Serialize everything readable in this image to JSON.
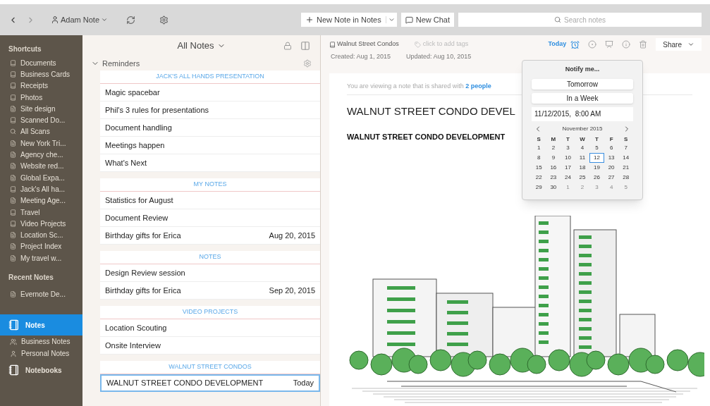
{
  "toolbar": {
    "account": "Adam Note",
    "new_note": "New Note in Notes",
    "new_chat": "New Chat",
    "search_placeholder": "Search notes"
  },
  "sidebar": {
    "shortcuts_title": "Shortcuts",
    "shortcuts": [
      {
        "label": "Documents",
        "kind": "notebook"
      },
      {
        "label": "Business Cards",
        "kind": "notebook"
      },
      {
        "label": "Receipts",
        "kind": "notebook"
      },
      {
        "label": "Photos",
        "kind": "notebook"
      },
      {
        "label": "Site design",
        "kind": "note"
      },
      {
        "label": "Scanned Do...",
        "kind": "notebook"
      },
      {
        "label": "All Scans",
        "kind": "search"
      },
      {
        "label": "New York Tri...",
        "kind": "note"
      },
      {
        "label": "Agency che...",
        "kind": "note"
      },
      {
        "label": "Website red...",
        "kind": "note"
      },
      {
        "label": "Global Expa...",
        "kind": "note"
      },
      {
        "label": "Jack's All ha...",
        "kind": "notebook"
      },
      {
        "label": "Meeting Age...",
        "kind": "note"
      },
      {
        "label": "Travel",
        "kind": "notebook"
      },
      {
        "label": "Video Projects",
        "kind": "notebook"
      },
      {
        "label": "Location Sc...",
        "kind": "note"
      },
      {
        "label": "Project Index",
        "kind": "note"
      },
      {
        "label": "My travel w...",
        "kind": "note"
      }
    ],
    "recent_title": "Recent Notes",
    "recent": [
      {
        "label": "Evernote De...",
        "kind": "note"
      }
    ],
    "nav": [
      {
        "label": "Notes",
        "kind": "main",
        "selected": true
      },
      {
        "label": "Business Notes",
        "kind": "sub",
        "selected": false
      },
      {
        "label": "Personal Notes",
        "kind": "person",
        "selected": false
      },
      {
        "label": "Notebooks",
        "kind": "main",
        "selected": false
      }
    ]
  },
  "notes_list": {
    "title": "All Notes",
    "reminders": {
      "label": "Reminders",
      "expanded": true
    },
    "groups": [
      {
        "title": "JACK'S ALL HANDS PRESENTATION",
        "items": [
          {
            "title": "Magic spacebar",
            "selected": false
          },
          {
            "title": "Phil's 3 rules for presentations",
            "selected": false
          },
          {
            "title": "Document handling",
            "selected": false
          },
          {
            "title": "Meetings happen",
            "selected": false
          },
          {
            "title": "What's Next",
            "selected": false
          }
        ]
      },
      {
        "title": "MY NOTES",
        "items": [
          {
            "title": "Statistics for August",
            "selected": false
          },
          {
            "title": "Document Review",
            "selected": false
          },
          {
            "title": "Birthday gifts for Erica",
            "date": "Aug 20, 2015",
            "selected": false
          }
        ]
      },
      {
        "title": "NOTES",
        "items": [
          {
            "title": "Design Review session",
            "selected": false
          },
          {
            "title": "Birthday gifts for Erica",
            "date": "Sep 20, 2015",
            "selected": false
          }
        ]
      },
      {
        "title": "VIDEO PROJECTS",
        "items": [
          {
            "title": "Location Scouting",
            "selected": false
          },
          {
            "title": "Onsite Interview",
            "selected": false
          }
        ]
      },
      {
        "title": "WALNUT STREET CONDOS",
        "items": [
          {
            "title": "WALNUT STREET CONDO DEVELOPMENT",
            "date": "Today",
            "selected": true
          }
        ]
      }
    ]
  },
  "editor": {
    "notebook": "Walnut Street Condos",
    "tags_placeholder": "click to add tags",
    "reminder": "Today",
    "share": "Share",
    "created": "Created: Aug 1, 2015",
    "updated": "Updated: Aug 10, 2015",
    "shared_text": "You are viewing a note that is shared with",
    "shared_link": "2 people",
    "title": "WALNUT STREET CONDO DEVEL",
    "heading": "WALNUT STREET CONDO DEVELOPMENT"
  },
  "reminder_popover": {
    "title": "Notify me...",
    "options": [
      "Tomorrow",
      "In a Week"
    ],
    "datetime": "11/12/2015,  8:00 AM",
    "month": "November 2015",
    "weekdays": [
      "S",
      "M",
      "T",
      "W",
      "T",
      "F",
      "S"
    ],
    "days": [
      {
        "label": "1",
        "kind": "current",
        "selected": false
      },
      {
        "label": "2",
        "kind": "current",
        "selected": false
      },
      {
        "label": "3",
        "kind": "current",
        "selected": false
      },
      {
        "label": "4",
        "kind": "current",
        "selected": false
      },
      {
        "label": "5",
        "kind": "current",
        "selected": false
      },
      {
        "label": "6",
        "kind": "current",
        "selected": false
      },
      {
        "label": "7",
        "kind": "current",
        "selected": false
      },
      {
        "label": "8",
        "kind": "current",
        "selected": false
      },
      {
        "label": "9",
        "kind": "current",
        "selected": false
      },
      {
        "label": "10",
        "kind": "current",
        "selected": false
      },
      {
        "label": "11",
        "kind": "current",
        "selected": false
      },
      {
        "label": "12",
        "kind": "current",
        "selected": true
      },
      {
        "label": "13",
        "kind": "current",
        "selected": false
      },
      {
        "label": "14",
        "kind": "current",
        "selected": false
      },
      {
        "label": "15",
        "kind": "current",
        "selected": false
      },
      {
        "label": "16",
        "kind": "current",
        "selected": false
      },
      {
        "label": "17",
        "kind": "current",
        "selected": false
      },
      {
        "label": "18",
        "kind": "current",
        "selected": false
      },
      {
        "label": "19",
        "kind": "current",
        "selected": false
      },
      {
        "label": "20",
        "kind": "current",
        "selected": false
      },
      {
        "label": "21",
        "kind": "current",
        "selected": false
      },
      {
        "label": "22",
        "kind": "current",
        "selected": false
      },
      {
        "label": "23",
        "kind": "current",
        "selected": false
      },
      {
        "label": "24",
        "kind": "current",
        "selected": false
      },
      {
        "label": "25",
        "kind": "current",
        "selected": false
      },
      {
        "label": "26",
        "kind": "current",
        "selected": false
      },
      {
        "label": "27",
        "kind": "current",
        "selected": false
      },
      {
        "label": "28",
        "kind": "current",
        "selected": false
      },
      {
        "label": "29",
        "kind": "current",
        "selected": false
      },
      {
        "label": "30",
        "kind": "current",
        "selected": false
      },
      {
        "label": "1",
        "kind": "other",
        "selected": false
      },
      {
        "label": "2",
        "kind": "other",
        "selected": false
      },
      {
        "label": "3",
        "kind": "other",
        "selected": false
      },
      {
        "label": "4",
        "kind": "other",
        "selected": false
      },
      {
        "label": "5",
        "kind": "other",
        "selected": false
      }
    ]
  }
}
